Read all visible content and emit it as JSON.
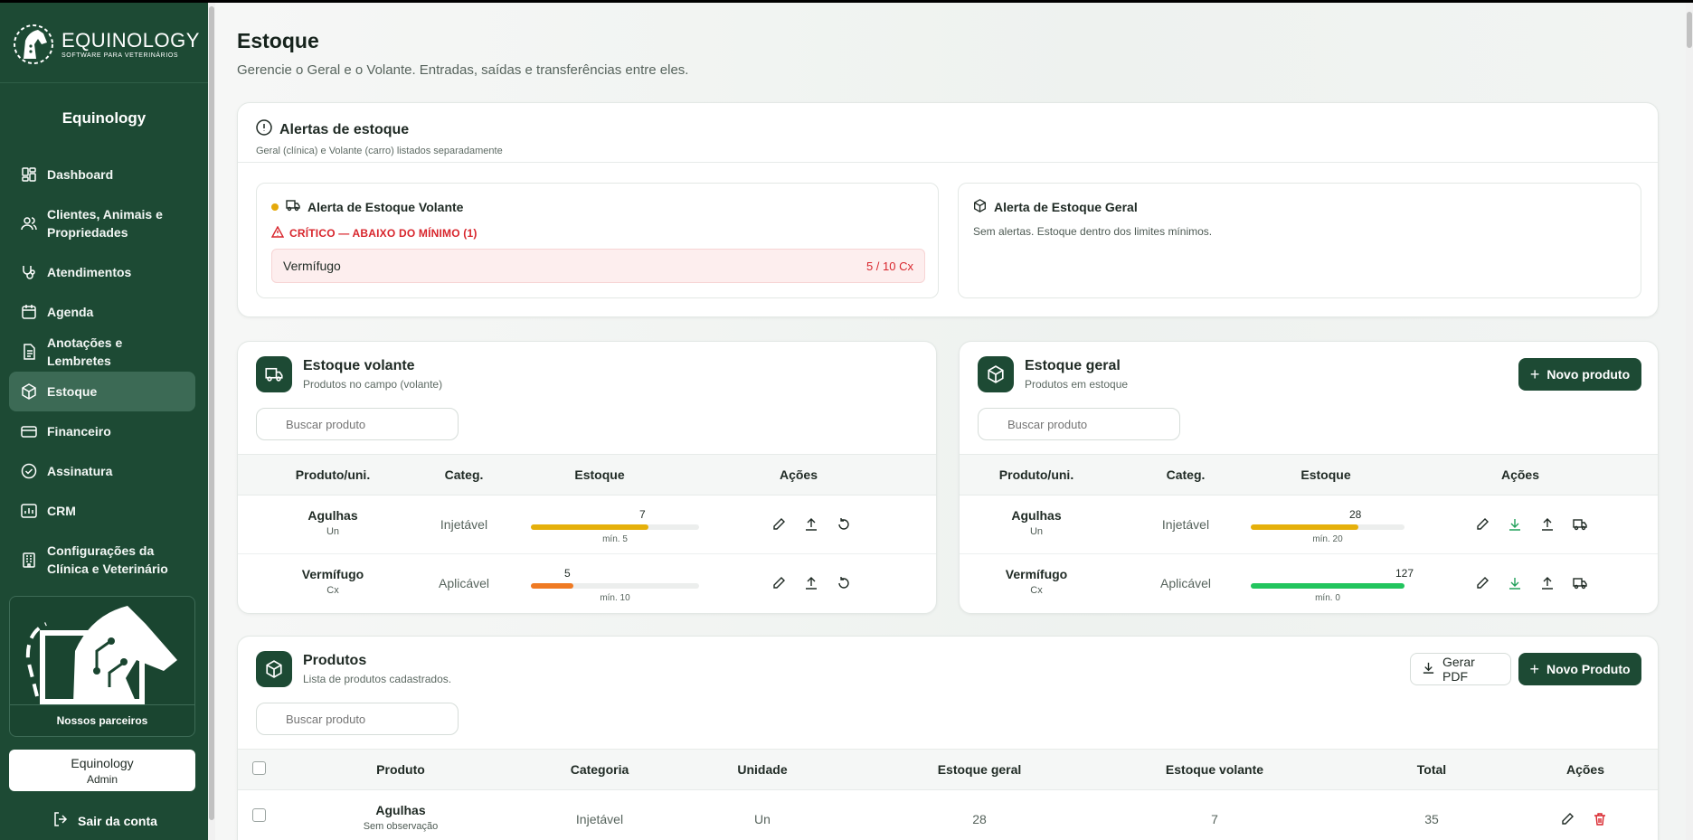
{
  "brand": {
    "name": "EQUINOLOGY",
    "tagline": "SOFTWARE PARA VETERINÁRIOS"
  },
  "sidebar": {
    "title": "Equinology",
    "items": [
      {
        "label": "Dashboard",
        "icon": "dashboard-icon"
      },
      {
        "label": "Clientes, Animais e Propriedades",
        "icon": "users-icon"
      },
      {
        "label": "Atendimentos",
        "icon": "stethoscope-icon"
      },
      {
        "label": "Agenda",
        "icon": "calendar-icon"
      },
      {
        "label": "Anotações e Lembretes",
        "icon": "notes-icon"
      },
      {
        "label": "Estoque",
        "icon": "box-icon",
        "active": true
      },
      {
        "label": "Financeiro",
        "icon": "wallet-icon"
      },
      {
        "label": "Assinatura",
        "icon": "check-circle-icon"
      },
      {
        "label": "CRM",
        "icon": "chart-icon"
      },
      {
        "label": "Configurações da Clínica e Veterinário",
        "icon": "building-icon"
      }
    ],
    "partners_label": "Nossos parceiros",
    "user": {
      "name": "Equinology",
      "role": "Admin"
    },
    "logout_label": "Sair da conta"
  },
  "page": {
    "title": "Estoque",
    "subtitle": "Gerencie o Geral e o Volante. Entradas, saídas e transferências entre eles."
  },
  "alerts": {
    "title": "Alertas de estoque",
    "subtitle": "Geral (clínica) e Volante (carro) listados separadamente",
    "volante": {
      "title": "Alerta de Estoque Volante",
      "critical_label": "CRÍTICO — ABAIXO DO MÍNIMO (1)",
      "items": [
        {
          "name": "Vermífugo",
          "value": "5 / 10 Cx"
        }
      ]
    },
    "geral": {
      "title": "Alerta de Estoque Geral",
      "message": "Sem alertas. Estoque dentro dos limites mínimos."
    }
  },
  "volante": {
    "title": "Estoque volante",
    "subtitle": "Produtos no campo (volante)",
    "search_placeholder": "Buscar produto",
    "headers": {
      "product": "Produto/uni.",
      "category": "Categ.",
      "stock": "Estoque",
      "actions": "Ações"
    },
    "rows": [
      {
        "name": "Agulhas",
        "unit": "Un",
        "category": "Injetável",
        "qty": "7",
        "min": "mín. 5",
        "fill": 0.7,
        "color": "#e5b00b"
      },
      {
        "name": "Vermífugo",
        "unit": "Cx",
        "category": "Aplicável",
        "qty": "5",
        "min": "mín. 10",
        "fill": 0.25,
        "color": "#ef7a23"
      }
    ]
  },
  "geral": {
    "title": "Estoque geral",
    "subtitle": "Produtos em estoque",
    "new_button": "Novo produto",
    "search_placeholder": "Buscar produto",
    "headers": {
      "product": "Produto/uni.",
      "category": "Categ.",
      "stock": "Estoque",
      "actions": "Ações"
    },
    "rows": [
      {
        "name": "Agulhas",
        "unit": "Un",
        "category": "Injetável",
        "qty": "28",
        "min": "mín. 20",
        "fill": 0.7,
        "color": "#e5b00b"
      },
      {
        "name": "Vermífugo",
        "unit": "Cx",
        "category": "Aplicável",
        "qty": "127",
        "min": "mín. 0",
        "fill": 1.0,
        "color": "#22c55e"
      }
    ]
  },
  "products": {
    "title": "Produtos",
    "subtitle": "Lista de produtos cadastrados.",
    "pdf_button": "Gerar PDF",
    "new_button": "Novo Produto",
    "search_placeholder": "Buscar produto",
    "headers": {
      "product": "Produto",
      "category": "Categoria",
      "unit": "Unidade",
      "general": "Estoque geral",
      "volante": "Estoque volante",
      "total": "Total",
      "actions": "Ações"
    },
    "rows": [
      {
        "name": "Agulhas",
        "note": "Sem observação",
        "category": "Injetável",
        "unit": "Un",
        "general": "28",
        "volante": "7",
        "total": "35"
      }
    ]
  },
  "colors": {
    "sidebar": "#1d4a34",
    "active": "#3c6a55",
    "critical": "#d8252c",
    "accent": "#1d4a34"
  }
}
